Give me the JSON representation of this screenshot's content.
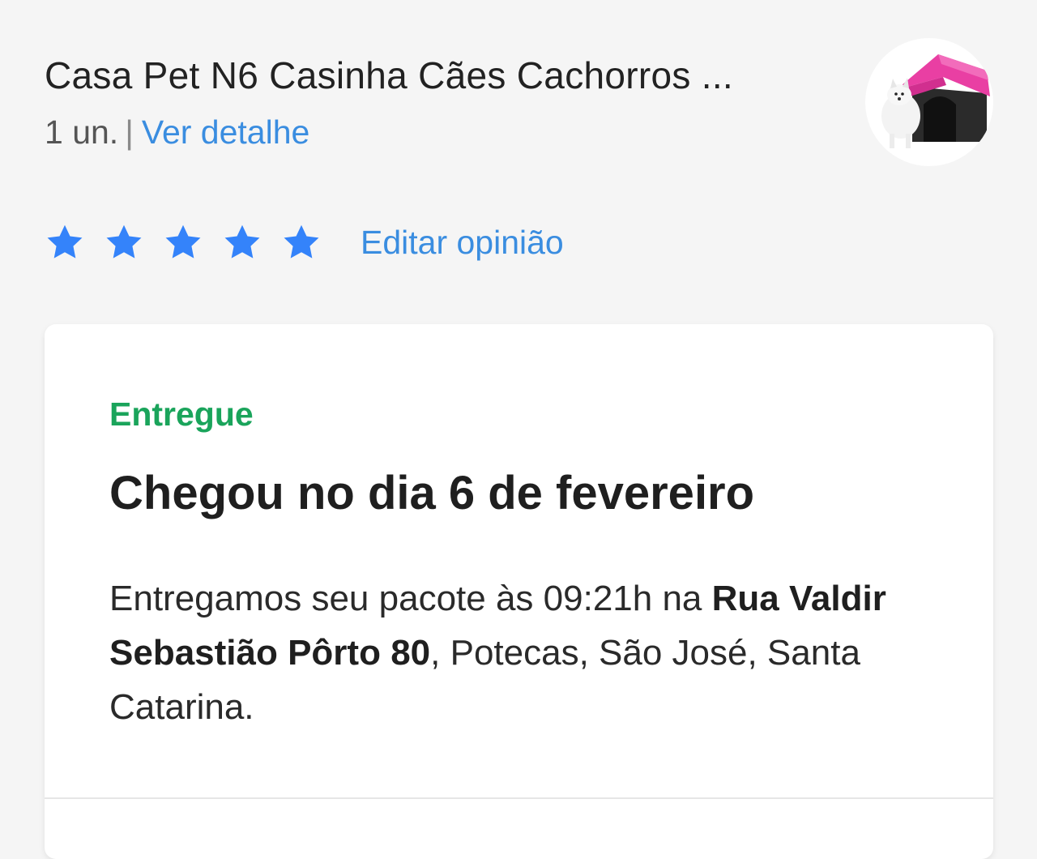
{
  "product": {
    "title": "Casa Pet N6 Casinha Cães Cachorros ...",
    "quantity": "1 un.",
    "separator": "|",
    "details_link": "Ver detalhe",
    "image_icon": "dog-house-product-image"
  },
  "rating": {
    "value": 5,
    "max": 5,
    "star_color": "#3483fa",
    "edit_label": "Editar opinião"
  },
  "delivery": {
    "status": "Entregue",
    "status_color": "#00a650",
    "heading": "Chegou no dia 6 de fevereiro",
    "text_before": "Entregamos seu pacote às 09:21h na ",
    "address_bold": "Rua Valdir Sebastião Pôrto 80",
    "text_after": ", Potecas, São José, Santa Catarina."
  },
  "colors": {
    "link": "#3a8de0",
    "background": "#f5f5f5"
  }
}
